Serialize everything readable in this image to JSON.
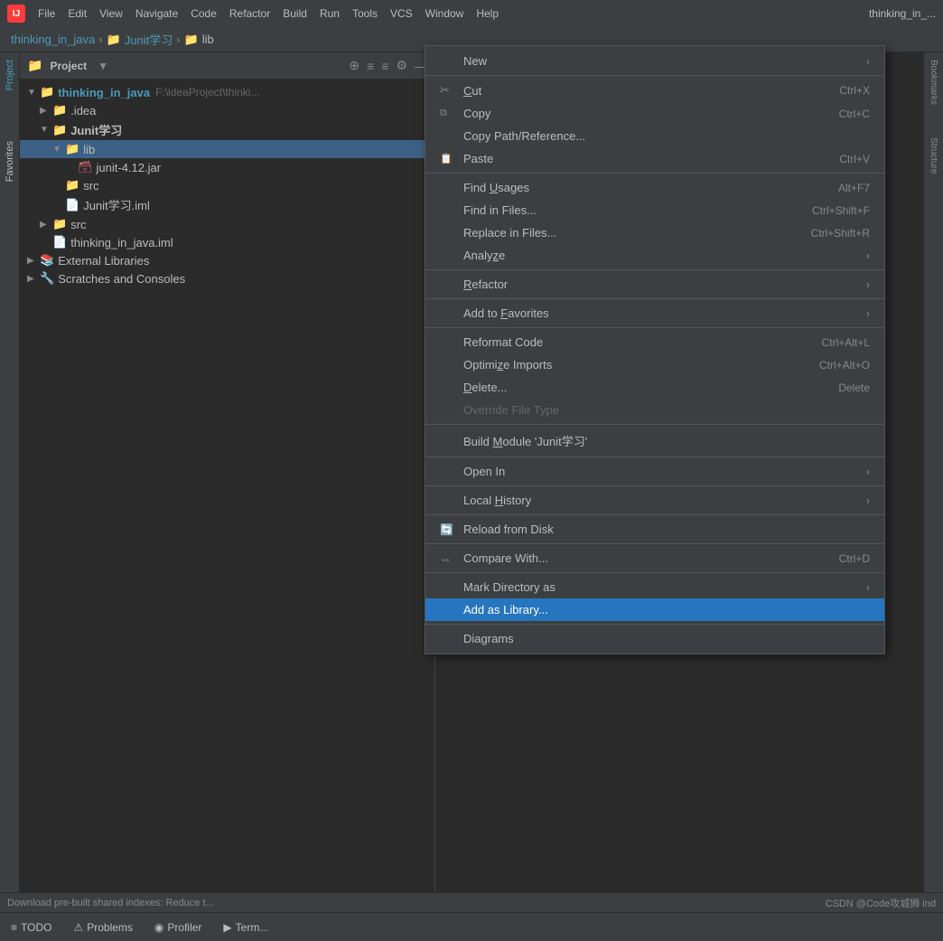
{
  "titlebar": {
    "logo": "IJ",
    "menu": [
      "File",
      "Edit",
      "View",
      "Navigate",
      "Code",
      "Refactor",
      "Build",
      "Run",
      "Tools",
      "VCS",
      "Window",
      "Help"
    ],
    "window_title": "thinking_in_..."
  },
  "breadcrumb": {
    "items": [
      "thinking_in_java",
      "Junit学习",
      "lib"
    ]
  },
  "project_panel": {
    "title": "Project",
    "tree": [
      {
        "id": "root",
        "level": 0,
        "arrow": "▼",
        "icon": "📁",
        "name": "thinking_in_java",
        "suffix": " F:\\ideaProject\\thinki...",
        "type": "root"
      },
      {
        "id": "idea",
        "level": 1,
        "arrow": "▶",
        "icon": "📁",
        "name": ".idea",
        "type": "folder"
      },
      {
        "id": "junit",
        "level": 1,
        "arrow": "▼",
        "icon": "📁",
        "name": "Junit学习",
        "type": "folder",
        "bold": true
      },
      {
        "id": "lib",
        "level": 2,
        "arrow": "▼",
        "icon": "📁",
        "name": "lib",
        "type": "folder",
        "selected": true
      },
      {
        "id": "jar",
        "level": 3,
        "arrow": "",
        "icon": "🗃",
        "name": "junit-4.12.jar",
        "type": "jar"
      },
      {
        "id": "src1",
        "level": 2,
        "arrow": "",
        "icon": "📁",
        "name": "src",
        "type": "folder"
      },
      {
        "id": "iml1",
        "level": 2,
        "arrow": "",
        "icon": "📄",
        "name": "Junit学习.iml",
        "type": "iml"
      },
      {
        "id": "src2",
        "level": 1,
        "arrow": "▶",
        "icon": "📁",
        "name": "src",
        "type": "folder"
      },
      {
        "id": "iml2",
        "level": 1,
        "arrow": "",
        "icon": "📄",
        "name": "thinking_in_java.iml",
        "type": "iml"
      },
      {
        "id": "ext",
        "level": 0,
        "arrow": "▶",
        "icon": "📚",
        "name": "External Libraries",
        "type": "folder"
      },
      {
        "id": "scratch",
        "level": 0,
        "arrow": "▶",
        "icon": "🔧",
        "name": "Scratches and Consoles",
        "type": "folder"
      }
    ]
  },
  "context_menu": {
    "items": [
      {
        "id": "new",
        "label": "New",
        "icon": "",
        "shortcut": "",
        "arrow": ">",
        "type": "item"
      },
      {
        "type": "divider"
      },
      {
        "id": "cut",
        "label": "Cut",
        "icon": "✂",
        "shortcut": "Ctrl+X",
        "type": "item"
      },
      {
        "id": "copy",
        "label": "Copy",
        "icon": "📋",
        "shortcut": "Ctrl+C",
        "type": "item"
      },
      {
        "id": "copy-path",
        "label": "Copy Path/Reference...",
        "icon": "",
        "shortcut": "",
        "type": "item"
      },
      {
        "id": "paste",
        "label": "Paste",
        "icon": "📋",
        "shortcut": "Ctrl+V",
        "type": "item"
      },
      {
        "type": "divider"
      },
      {
        "id": "find-usages",
        "label": "Find Usages",
        "icon": "",
        "shortcut": "Alt+F7",
        "type": "item"
      },
      {
        "id": "find-files",
        "label": "Find in Files...",
        "icon": "",
        "shortcut": "Ctrl+Shift+F",
        "type": "item"
      },
      {
        "id": "replace-files",
        "label": "Replace in Files...",
        "icon": "",
        "shortcut": "Ctrl+Shift+R",
        "type": "item"
      },
      {
        "id": "analyze",
        "label": "Analyze",
        "icon": "",
        "shortcut": "",
        "arrow": ">",
        "type": "item"
      },
      {
        "type": "divider"
      },
      {
        "id": "refactor",
        "label": "Refactor",
        "icon": "",
        "shortcut": "",
        "arrow": ">",
        "type": "item"
      },
      {
        "type": "divider"
      },
      {
        "id": "add-favorites",
        "label": "Add to Favorites",
        "icon": "",
        "shortcut": "",
        "arrow": ">",
        "type": "item"
      },
      {
        "type": "divider"
      },
      {
        "id": "reformat",
        "label": "Reformat Code",
        "icon": "",
        "shortcut": "Ctrl+Alt+L",
        "type": "item"
      },
      {
        "id": "optimize",
        "label": "Optimize Imports",
        "icon": "",
        "shortcut": "Ctrl+Alt+O",
        "type": "item"
      },
      {
        "id": "delete",
        "label": "Delete...",
        "icon": "",
        "shortcut": "Delete",
        "type": "item"
      },
      {
        "id": "override-file-type",
        "label": "Override File Type",
        "icon": "",
        "shortcut": "",
        "type": "item",
        "disabled": true
      },
      {
        "type": "divider"
      },
      {
        "id": "build-module",
        "label": "Build Module 'Junit学习'",
        "icon": "",
        "shortcut": "",
        "type": "item"
      },
      {
        "type": "divider"
      },
      {
        "id": "open-in",
        "label": "Open In",
        "icon": "",
        "shortcut": "",
        "arrow": ">",
        "type": "item"
      },
      {
        "type": "divider"
      },
      {
        "id": "local-history",
        "label": "Local History",
        "icon": "",
        "shortcut": "",
        "arrow": ">",
        "type": "item"
      },
      {
        "type": "divider"
      },
      {
        "id": "reload",
        "label": "Reload from Disk",
        "icon": "🔄",
        "shortcut": "",
        "type": "item"
      },
      {
        "type": "divider"
      },
      {
        "id": "compare-with",
        "label": "Compare With...",
        "icon": "↔",
        "shortcut": "Ctrl+D",
        "type": "item"
      },
      {
        "type": "divider"
      },
      {
        "id": "mark-dir",
        "label": "Mark Directory as",
        "icon": "",
        "shortcut": "",
        "arrow": ">",
        "type": "item"
      },
      {
        "id": "add-library",
        "label": "Add as Library...",
        "icon": "",
        "shortcut": "",
        "type": "item",
        "highlighted": true
      },
      {
        "type": "divider"
      },
      {
        "id": "diagrams",
        "label": "Diagrams",
        "icon": "",
        "shortcut": "",
        "arrow": "",
        "type": "item"
      }
    ]
  },
  "bottom_tabs": [
    {
      "id": "todo",
      "icon": "≡",
      "label": "TODO"
    },
    {
      "id": "problems",
      "icon": "⚠",
      "label": "Problems"
    },
    {
      "id": "profiler",
      "icon": "◉",
      "label": "Profiler"
    },
    {
      "id": "terminal",
      "icon": "▶",
      "label": "Term..."
    }
  ],
  "status_bar": {
    "text": "Download pre-built shared indexes: Reduce t...",
    "right": "CSDN @Code攻城狮    ind"
  },
  "right_tabs": [
    "Bookmarks",
    "Structure"
  ],
  "left_sidebar_tabs": [
    "Project",
    "Favorites"
  ]
}
